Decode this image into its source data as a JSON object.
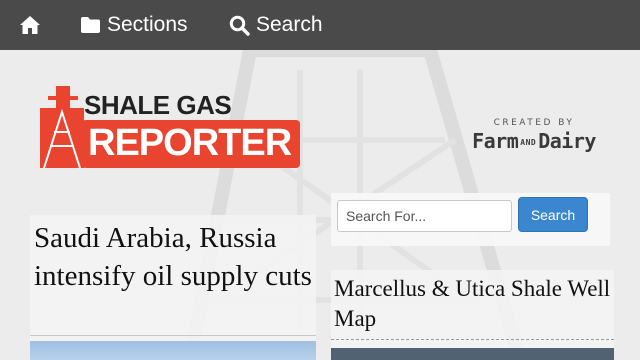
{
  "nav": {
    "home_icon": "home-icon",
    "sections_label": "Sections",
    "sections_icon": "folder-icon",
    "search_label": "Search",
    "search_icon": "search-icon"
  },
  "logo": {
    "line1": "SHALE GAS",
    "line2": "REPORTER",
    "accent_color": "#e8442f"
  },
  "credit": {
    "created_by": "CREATED BY",
    "brand_left": "Farm",
    "brand_and": "AND",
    "brand_right": "Dairy"
  },
  "search": {
    "placeholder": "Search For...",
    "value": "",
    "button_label": "Search",
    "button_color": "#3b87cf"
  },
  "article": {
    "headline": "Saudi Arabia, Russia intensify oil supply cuts"
  },
  "widget": {
    "title": "Marcellus & Utica Shale Well Map"
  },
  "colors": {
    "nav_bg": "#4a4a4a",
    "page_bg": "#ececec"
  }
}
